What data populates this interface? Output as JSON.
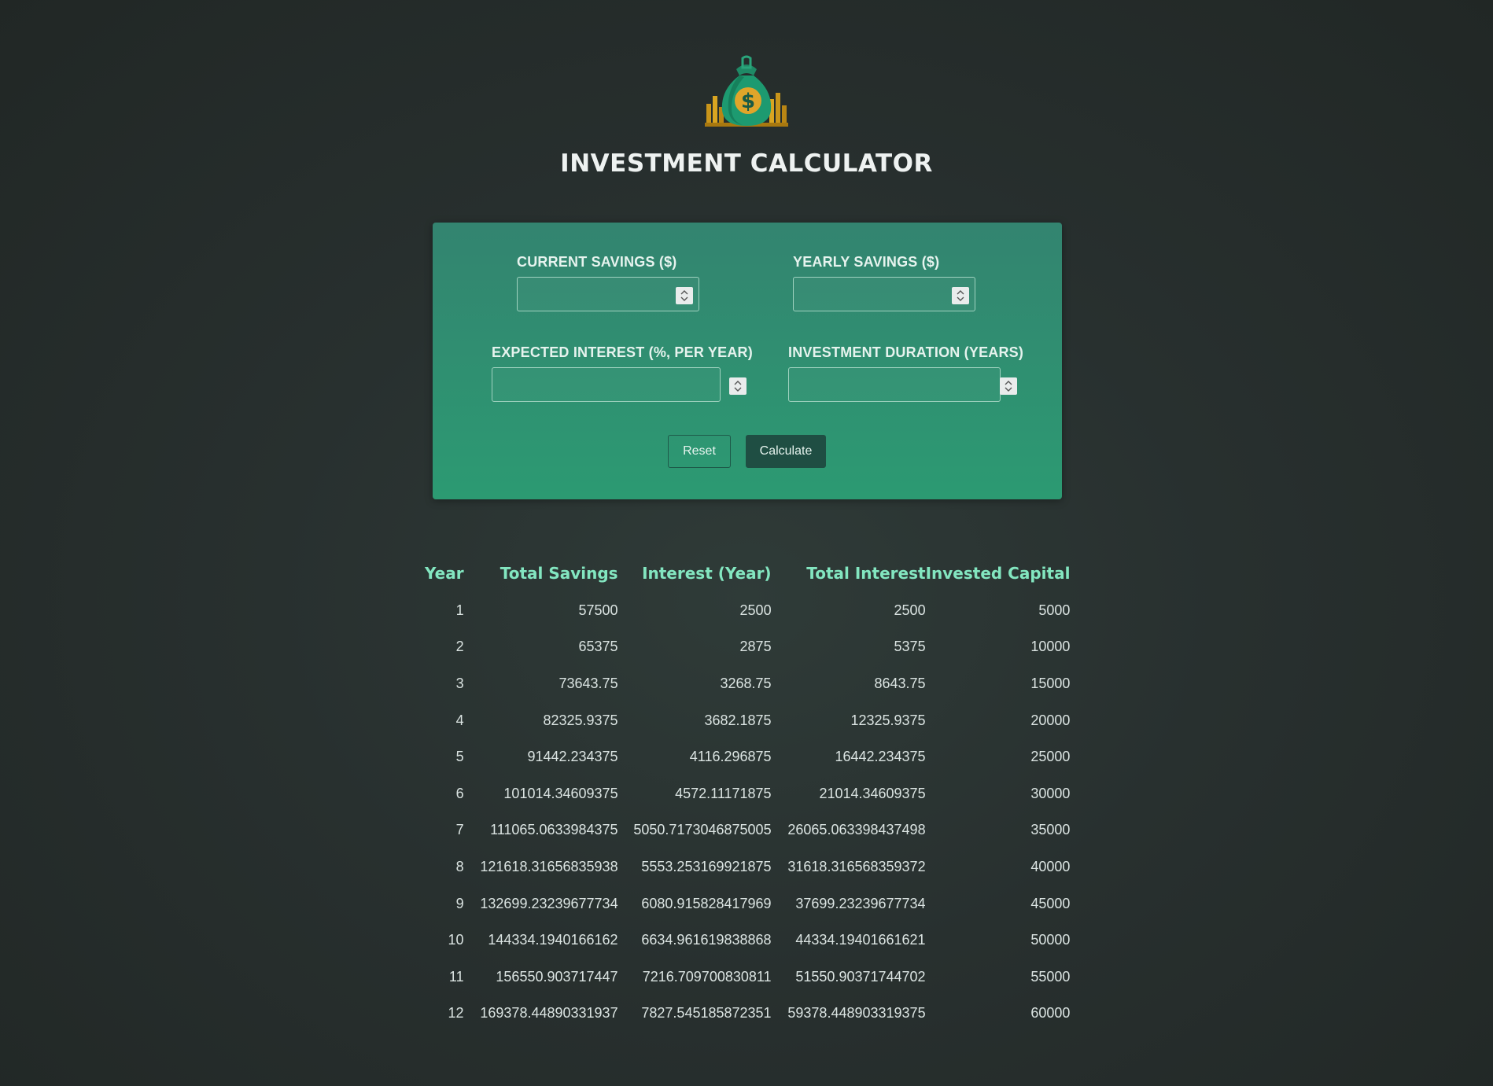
{
  "header": {
    "title": "INVESTMENT CALCULATOR",
    "logo_icon": "money-bag-icon"
  },
  "form": {
    "fields": [
      {
        "label": "CURRENT SAVINGS ($)",
        "value": "",
        "placeholder": ""
      },
      {
        "label": "YEARLY SAVINGS ($)",
        "value": "",
        "placeholder": ""
      },
      {
        "label": "EXPECTED INTEREST (%, PER YEAR)",
        "value": "",
        "placeholder": ""
      },
      {
        "label": "INVESTMENT DURATION (YEARS)",
        "value": "",
        "placeholder": ""
      }
    ],
    "reset_label": "Reset",
    "calculate_label": "Calculate"
  },
  "table": {
    "headers": [
      "Year",
      "Total Savings",
      "Interest (Year)",
      "Total Interest",
      "Invested Capital"
    ],
    "rows": [
      [
        "1",
        "57500",
        "2500",
        "2500",
        "5000"
      ],
      [
        "2",
        "65375",
        "2875",
        "5375",
        "10000"
      ],
      [
        "3",
        "73643.75",
        "3268.75",
        "8643.75",
        "15000"
      ],
      [
        "4",
        "82325.9375",
        "3682.1875",
        "12325.9375",
        "20000"
      ],
      [
        "5",
        "91442.234375",
        "4116.296875",
        "16442.234375",
        "25000"
      ],
      [
        "6",
        "101014.34609375",
        "4572.11171875",
        "21014.34609375",
        "30000"
      ],
      [
        "7",
        "111065.0633984375",
        "5050.7173046875005",
        "26065.063398437498",
        "35000"
      ],
      [
        "8",
        "121618.31656835938",
        "5553.253169921875",
        "31618.316568359372",
        "40000"
      ],
      [
        "9",
        "132699.23239677734",
        "6080.915828417969",
        "37699.23239677734",
        "45000"
      ],
      [
        "10",
        "144334.1940166162",
        "6634.961619838868",
        "44334.19401661621",
        "50000"
      ],
      [
        "11",
        "156550.903717447",
        "7216.709700830811",
        "51550.90371744702",
        "55000"
      ],
      [
        "12",
        "169378.44890331937",
        "7827.545185872351",
        "59378.448903319375",
        "60000"
      ]
    ]
  },
  "colors": {
    "panel_top": "#338470",
    "panel_bottom": "#2c9a72",
    "header_text": "#83e6c0",
    "calculate_button": "#1f4e43"
  }
}
